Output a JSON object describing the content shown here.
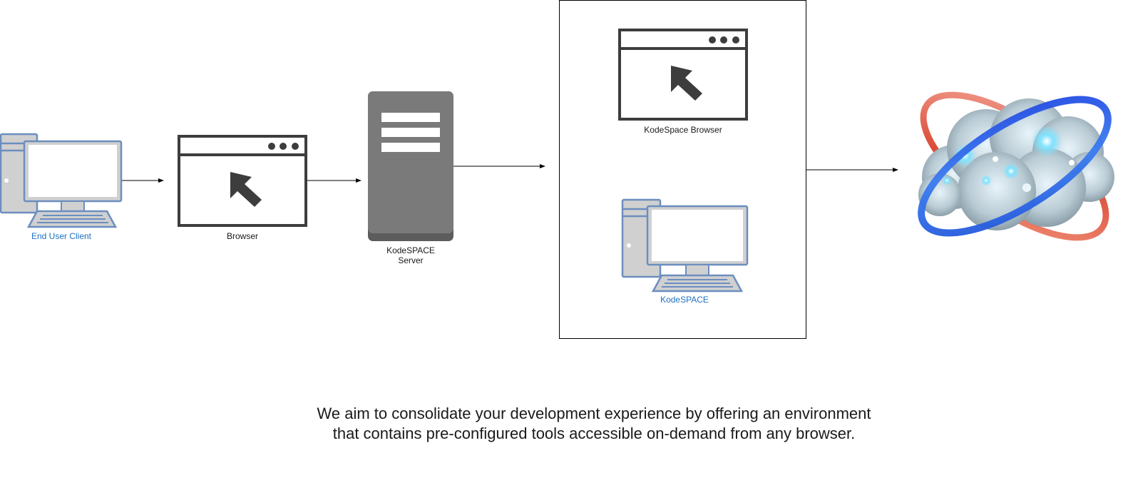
{
  "nodes": {
    "end_user_client": {
      "label": "End User Client",
      "icon": "desktop-computer-icon"
    },
    "browser": {
      "label": "Browser",
      "icon": "browser-window-icon"
    },
    "server": {
      "label": "KodeSPACE\nServer",
      "icon": "server-icon"
    },
    "kodespace_browser": {
      "label": "KodeSpace Browser",
      "icon": "browser-window-icon"
    },
    "kodespace": {
      "label": "KodeSPACE",
      "icon": "desktop-computer-icon"
    },
    "cloud": {
      "icon": "cloud-orbit-icon"
    }
  },
  "edges": [
    {
      "from": "end_user_client",
      "to": "browser"
    },
    {
      "from": "browser",
      "to": "server"
    },
    {
      "from": "server",
      "to": "kodespace_container"
    },
    {
      "from": "kodespace_container",
      "to": "cloud"
    }
  ],
  "tagline": "We aim to consolidate your development experience by offering an environment\nthat contains pre-configured tools accessible on-demand from any browser.",
  "colors": {
    "computer_stroke": "#6c8ebf",
    "computer_fill": "#d0d0d0",
    "browser_stroke": "#3d3d3d",
    "server_fill": "#7a7a7a",
    "label_blue": "#1f6fc1"
  }
}
